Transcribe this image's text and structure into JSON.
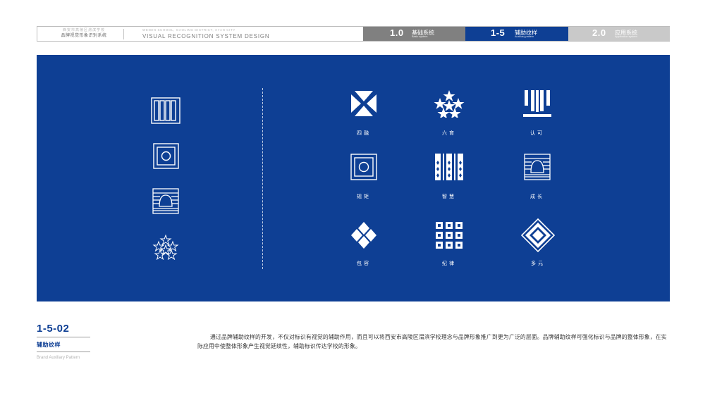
{
  "header": {
    "school_line1": "西安市高陵区渭滨学校",
    "school_line2": "品牌视觉形象识别系统",
    "en_line1": "WEIBIN SCHOOL, GAOLING DISTRICT, XI'AN CITY",
    "en_line2": "VISUAL RECOGNITION SYSTEM DESIGN",
    "tabs": [
      {
        "num": "1.0",
        "cn": "基础系统",
        "en": "Basic system"
      },
      {
        "num": "1-5",
        "cn": "辅助纹样",
        "en": "Auxiliary pattern"
      },
      {
        "num": "2.0",
        "cn": "应用系统",
        "en": "Application system"
      }
    ]
  },
  "panel": {
    "left_icons": [
      "columns-pattern-icon",
      "concentric-square-icon",
      "bell-lines-icon",
      "stars-outline-icon"
    ],
    "grid": [
      {
        "icon": "four-triangles-icon",
        "label": "四融"
      },
      {
        "icon": "six-stars-icon",
        "label": "六育"
      },
      {
        "icon": "shield-stripes-icon",
        "label": "认可"
      },
      {
        "icon": "concentric-square-icon",
        "label": "规矩"
      },
      {
        "icon": "dotted-bars-icon",
        "label": "智慧"
      },
      {
        "icon": "bell-lines-icon",
        "label": "成长"
      },
      {
        "icon": "four-diamonds-icon",
        "label": "包容"
      },
      {
        "icon": "grid-squares-icon",
        "label": "纪律"
      },
      {
        "icon": "nested-diamond-icon",
        "label": "多元"
      }
    ],
    "colors": {
      "background": "#0e3f94",
      "foreground": "#ffffff"
    }
  },
  "footer": {
    "code": "1-5-02",
    "title_cn": "辅助纹样",
    "title_en": "Brand Auxiliary Pattern",
    "description": "通过品牌辅助纹样的开发，不仅对标识有视觉的辅助作用，而且可以将西安市高陵区渭滨学校理念与品牌形象推广到更为广泛的层面。品牌辅助纹样可强化标识与品牌的整体形象，在实际应用中使整体形象产生视觉延续性，辅助标识传达学校的形象。"
  }
}
